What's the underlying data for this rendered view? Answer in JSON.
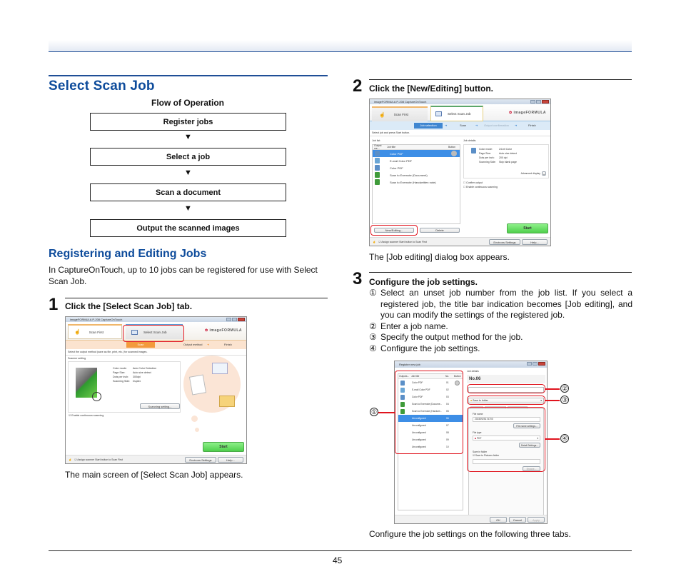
{
  "page": {
    "number": "45",
    "colors": {
      "heading": "#0d4b9b",
      "rule": "#1f4e96",
      "highlight": "#e0141e",
      "start_button": "#5fd85b"
    }
  },
  "section": {
    "title": "Select Scan Job",
    "flow": {
      "title": "Flow of Operation",
      "steps": [
        "Register jobs",
        "Select a job",
        "Scan a document",
        "Output the scanned images"
      ],
      "arrow": "▼"
    }
  },
  "subsection": {
    "title": "Registering and Editing Jobs",
    "intro": "In CaptureOnTouch, up to 10 jobs can be registered for use with Select Scan Job."
  },
  "steps": [
    {
      "number": "1",
      "title": "Click the [Select Scan Job] tab.",
      "caption": "The main screen of [Select Scan Job] appears.",
      "screenshot": {
        "window_title": "imageFORMULA P-208 CaptureOnTouch",
        "tabs": [
          "Scan First",
          "Select Scan Job"
        ],
        "brand": "imageFORMULA",
        "progress": [
          "Scan",
          "Output method",
          "Finish"
        ],
        "instruction": "Select the output method (save as file, print, etc.) for scanned images.",
        "group_label": "Scanner setting",
        "settings": [
          {
            "label": "Color mode:",
            "value": "Auto Color Detection"
          },
          {
            "label": "Page Size:",
            "value": "Auto size detect"
          },
          {
            "label": "Dots per inch:",
            "value": "300dpi"
          },
          {
            "label": "Scanning Side:",
            "value": "Duplex"
          }
        ],
        "scanning_setting_button": "Scanning setting...",
        "continuous_checkbox": "Enable continuous scanning",
        "start_button": "Start",
        "assign_checkbox": "Assign scanner Start button to Scan First",
        "env_settings_button": "Environs Settings",
        "help_button": "Help..."
      }
    },
    {
      "number": "2",
      "title": "Click the [New/Editing] button.",
      "caption": "The [Job editing] dialog box appears.",
      "screenshot": {
        "window_title": "imageFORMULA P-208 CaptureOnTouch",
        "tabs": [
          "Scan First",
          "Select Scan Job"
        ],
        "brand": "imageFORMULA",
        "progress": [
          "Job selection",
          "Scan",
          "Output confirmation",
          "Finish"
        ],
        "instruction": "Select job and press Start button.",
        "job_list_label": "Job list:",
        "columns": [
          "Output me...",
          "Job title",
          "Button"
        ],
        "jobs": [
          "Color PDF",
          "E-mail Color PDF",
          "Color PDF",
          "Scan to Evernote (Document)",
          "Scan to Evernote (Handwritten note)"
        ],
        "job_details_label": "Job details:",
        "details": [
          {
            "label": "Color mode:",
            "value": "24-bit Color"
          },
          {
            "label": "Page Size:",
            "value": "Auto size detect"
          },
          {
            "label": "Dots per inch:",
            "value": "200 dpi"
          },
          {
            "label": "Scanning Side:",
            "value": "Skip blank page"
          }
        ],
        "advanced_display": "Advanced display",
        "confirm_checkbox": "Confirm output",
        "continuous_checkbox": "Enable continuous scanning",
        "new_editing_button": "New/Editing...",
        "delete_button": "Delete",
        "start_button": "Start",
        "assign_checkbox": "Assign scanner Start button to Scan First",
        "env_settings_button": "Environs Settings",
        "help_button": "Help..."
      }
    },
    {
      "number": "3",
      "title": "Configure the job settings.",
      "items": [
        {
          "marker": "①",
          "text": "Select an unset job number from the job list. If you select a registered job, the title bar indication becomes [Job editing], and you can modify the settings of the registered job."
        },
        {
          "marker": "②",
          "text": "Enter a job name."
        },
        {
          "marker": "③",
          "text": "Specify the output method for the job."
        },
        {
          "marker": "④",
          "text": "Configure the job settings."
        }
      ],
      "caption": "Configure the job settings on the following three tabs.",
      "screenshot": {
        "window_title": "Register new job",
        "columns": [
          "Outputs...",
          "Job title",
          "No.",
          "Button"
        ],
        "jobs": [
          {
            "title": "Color PDF",
            "no": "01"
          },
          {
            "title": "E-mail Color PDF",
            "no": "02"
          },
          {
            "title": "Color PDF",
            "no": "03"
          },
          {
            "title": "Scan to Evernote (Docume...",
            "no": "04"
          },
          {
            "title": "Scan to Evernote (Handwri...",
            "no": "05"
          },
          {
            "title": "Unconfigured",
            "no": "06"
          },
          {
            "title": "Unconfigured",
            "no": "07"
          },
          {
            "title": "Unconfigured",
            "no": "08"
          },
          {
            "title": "Unconfigured",
            "no": "09"
          },
          {
            "title": "Unconfigured",
            "no": "10"
          }
        ],
        "selected_index": 5,
        "job_details_label": "Job details",
        "job_number": "No.06",
        "job_name_value": "",
        "output_method": "Save to folder",
        "file_name_label": "File name",
        "file_name_value": "20150925174700",
        "file_name_settings_button": "File name settings...",
        "file_type_label": "File type",
        "file_type_value": "PDF",
        "detail_settings_button": "Detail Settings...",
        "save_folder_label": "Save in folder",
        "save_pictures_checkbox": "Save to Pictures folder",
        "browse_button": "Browse...",
        "ok_button": "OK",
        "cancel_button": "Cancel",
        "apply_button": "Apply",
        "callouts": [
          "①",
          "②",
          "③",
          "④"
        ]
      }
    }
  ]
}
